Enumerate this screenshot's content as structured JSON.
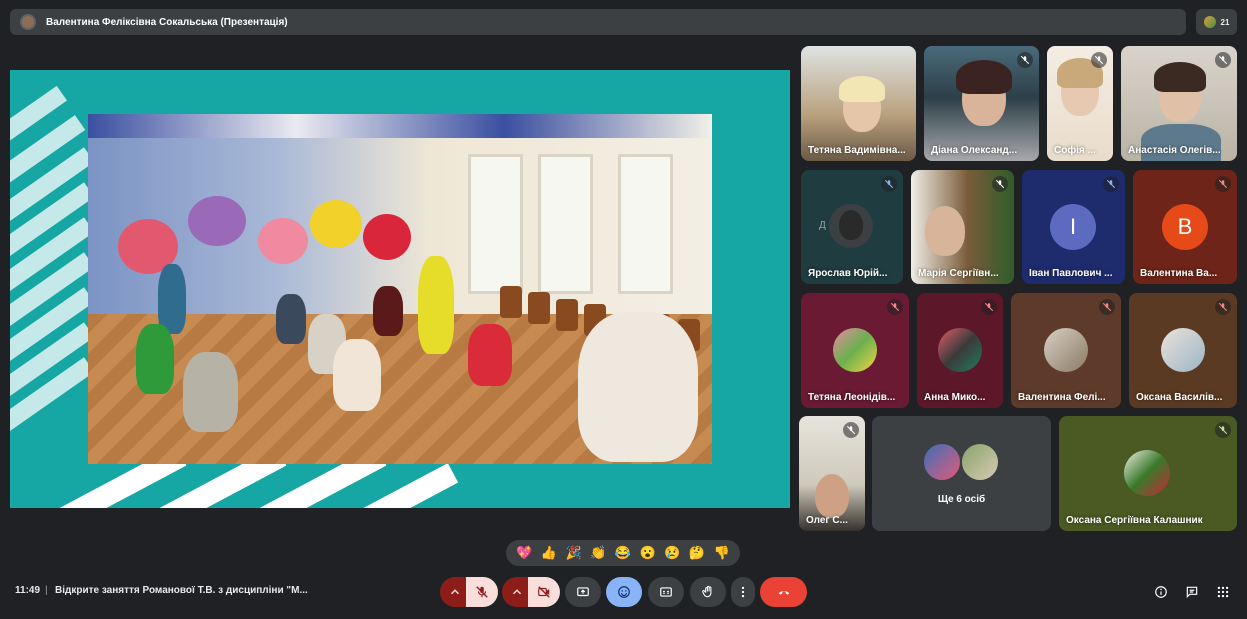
{
  "topbar": {
    "title": "Валентина Феліксівна Сокальська (Презентація)",
    "people_count": "21"
  },
  "tiles": [
    {
      "name": "Тетяна Вадимівна...",
      "muted": false
    },
    {
      "name": "Діана Олександ...",
      "muted": true
    },
    {
      "name": "Софія ...",
      "muted": true
    },
    {
      "name": "Анастасія Олегів...",
      "muted": true
    },
    {
      "name": "Ярослав Юрій...",
      "muted": true,
      "initial": "Д"
    },
    {
      "name": "Марія Сергіївн...",
      "muted": true
    },
    {
      "name": "Іван Павлович ...",
      "muted": true,
      "initial": "І"
    },
    {
      "name": "Валентина Ва...",
      "muted": true,
      "initial": "В"
    },
    {
      "name": "Тетяна Леонідів...",
      "muted": true
    },
    {
      "name": "Анна Мико...",
      "muted": true
    },
    {
      "name": "Валентина Фелі...",
      "muted": true
    },
    {
      "name": "Оксана Василів...",
      "muted": true
    },
    {
      "name": "Олег С...",
      "muted": true
    },
    {
      "name": "Ще 6 осіб",
      "muted": false
    },
    {
      "name": "Оксана Сергіївна Калашник",
      "muted": true
    }
  ],
  "reactions": [
    "💖",
    "👍",
    "🎉",
    "👏",
    "😂",
    "😮",
    "😢",
    "🤔",
    "👎"
  ],
  "bottombar": {
    "time": "11:49",
    "separator": "|",
    "meeting_title": "Відкрите заняття Романової Т.В. з дисципліни \"М..."
  },
  "colors": {
    "background": "#202124",
    "slide": "#16a6a3",
    "end_call": "#ea4335",
    "mic_off_bg": "#f9dedc",
    "accent_blue": "#8ab4f8"
  },
  "icons": [
    "chevron-up-icon",
    "mic-off-icon",
    "camera-off-icon",
    "present-icon",
    "emoji-icon",
    "captions-icon",
    "raise-hand-icon",
    "more-icon",
    "end-call-icon",
    "info-icon",
    "chat-icon",
    "activities-icon"
  ]
}
